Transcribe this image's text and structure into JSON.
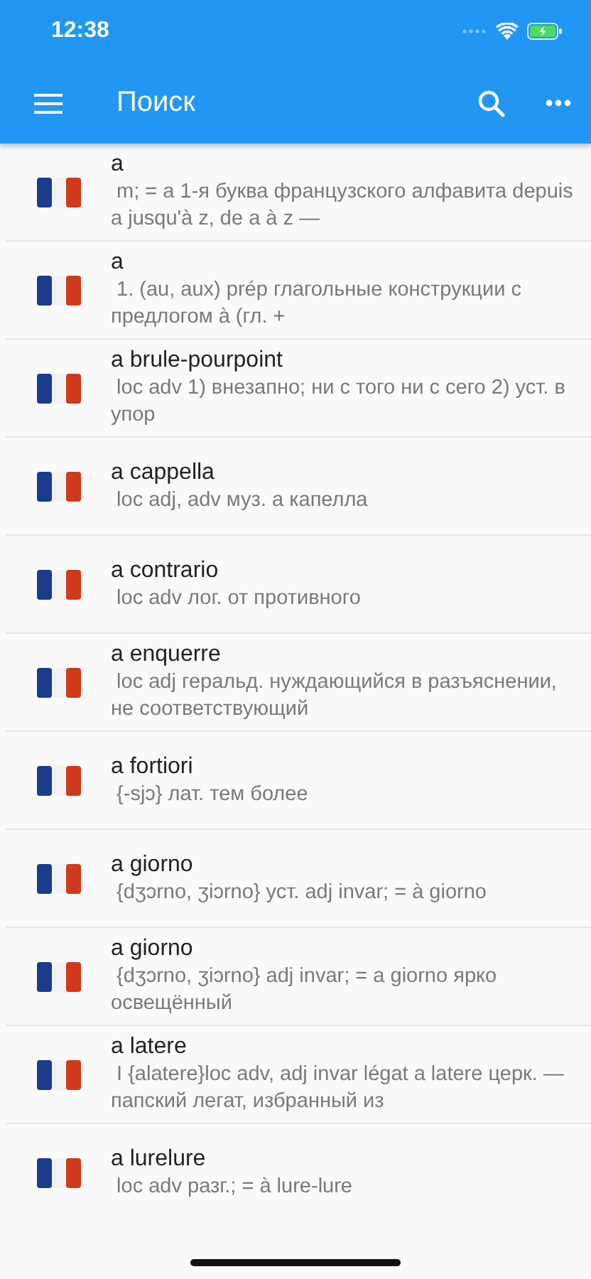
{
  "status_bar": {
    "time": "12:38"
  },
  "app_bar": {
    "title": "Поиск"
  },
  "results": [
    {
      "word": "a",
      "definition": " m; = a 1-я буква французского алфавита depuis a jusqu'à z, de a à z —"
    },
    {
      "word": "a",
      "definition": " 1. (au, aux) prép глагольные конструкции с предлогом à (гл. +"
    },
    {
      "word": "a brule-pourpoint",
      "definition": " loc adv 1) внезапно; ни с того ни с сего 2) уст. в упор"
    },
    {
      "word": "a cappella",
      "definition": " loc adj, adv муз. а капелла"
    },
    {
      "word": "a contrario",
      "definition": " loc adv лог. от противного"
    },
    {
      "word": "a enquerre",
      "definition": " loc adj геральд. нуждающийся в разъяснении, не соответствующий"
    },
    {
      "word": "a fortiori",
      "definition": " {-sjɔ} лат. тем более"
    },
    {
      "word": "a giorno",
      "definition": " {dʒɔrno, ʒiɔrno} уст. adj invar; = à giorno"
    },
    {
      "word": "a giorno",
      "definition": " {dʒɔrno, ʒiɔrno} adj invar; = a giorno ярко освещённый"
    },
    {
      "word": "a latere",
      "definition": " I {alatere}loc adv, adj invar légat a latere церк. — папский легат, избранный из"
    },
    {
      "word": "a lurelure",
      "definition": " loc adv разг.; = à lure-lure"
    }
  ]
}
